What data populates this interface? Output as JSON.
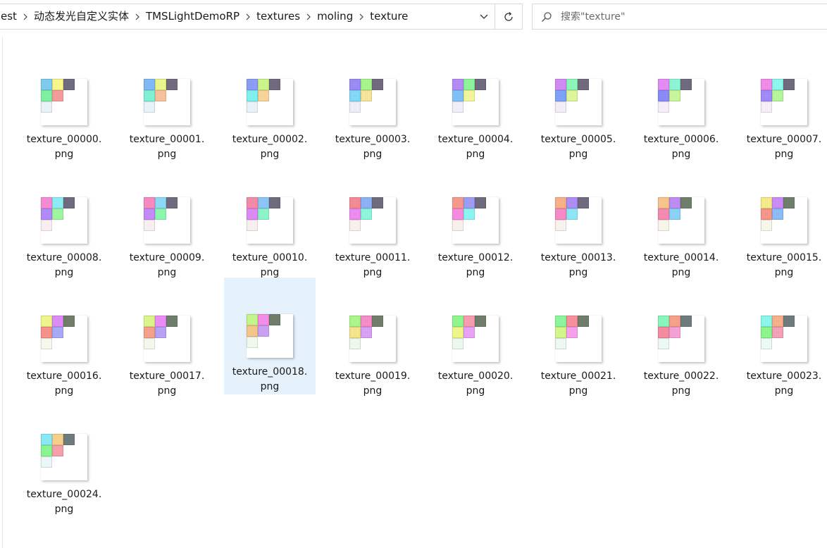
{
  "breadcrumb": {
    "items": [
      "est",
      "动态发光自定义实体",
      "TMSLightDemoRP",
      "textures",
      "moling",
      "texture"
    ]
  },
  "search": {
    "placeholder": "搜索\"texture\""
  },
  "colors": {
    "selection": "#e5f1fb",
    "border": "#d9d9d9"
  },
  "files": [
    {
      "name": "texture_00000.png",
      "line1": "texture_00000.",
      "line2": "png",
      "swatches": [
        "#7ecbf0",
        "#f6f48a",
        "#6f6a7d",
        "#7ff0a2",
        "#f59b9b",
        "#e6f2f8"
      ]
    },
    {
      "name": "texture_00001.png",
      "line1": "texture_00001.",
      "line2": "png",
      "swatches": [
        "#7fb8f5",
        "#e8f58a",
        "#6f6a7d",
        "#80f0d4",
        "#f7c09a",
        "#e6f2f8"
      ]
    },
    {
      "name": "texture_00002.png",
      "line1": "texture_00002.",
      "line2": "png",
      "swatches": [
        "#8a9cf5",
        "#caf58a",
        "#6f6a7d",
        "#7ff0f0",
        "#f7d29a",
        "#e6f2f8"
      ]
    },
    {
      "name": "texture_00003.png",
      "line1": "texture_00003.",
      "line2": "png",
      "swatches": [
        "#9a8af5",
        "#a7f58a",
        "#6f6a7d",
        "#7fd8f7",
        "#f7e39a",
        "#eeeef8"
      ]
    },
    {
      "name": "texture_00004.png",
      "line1": "texture_00004.",
      "line2": "png",
      "swatches": [
        "#b48af5",
        "#8cf59a",
        "#6f6a7d",
        "#7fc0f7",
        "#f2f59a",
        "#f0eef8"
      ]
    },
    {
      "name": "texture_00005.png",
      "line1": "texture_00005.",
      "line2": "png",
      "swatches": [
        "#d08af5",
        "#8cf5b8",
        "#6f6a7d",
        "#7fa0f7",
        "#dcf59a",
        "#f2eef8"
      ]
    },
    {
      "name": "texture_00006.png",
      "line1": "texture_00006.",
      "line2": "png",
      "swatches": [
        "#e38af5",
        "#8cf5d4",
        "#6f6a7d",
        "#8a8af7",
        "#c8f59a",
        "#f5eef8"
      ]
    },
    {
      "name": "texture_00007.png",
      "line1": "texture_00007.",
      "line2": "png",
      "swatches": [
        "#f08ae8",
        "#8cf5ee",
        "#6f6a7d",
        "#a08af7",
        "#b4f59a",
        "#f7eef5"
      ]
    },
    {
      "name": "texture_00008.png",
      "line1": "texture_00008.",
      "line2": "png",
      "swatches": [
        "#f58ad4",
        "#8cecf5",
        "#6f6a7d",
        "#b08af7",
        "#a0f5a0",
        "#f8eef2"
      ]
    },
    {
      "name": "texture_00009.png",
      "line1": "texture_00009.",
      "line2": "png",
      "swatches": [
        "#f58ac0",
        "#8cd8f5",
        "#6f6a7d",
        "#c48af7",
        "#8cf5b0",
        "#f8eef0"
      ]
    },
    {
      "name": "texture_00010.png",
      "line1": "texture_00010.",
      "line2": "png",
      "swatches": [
        "#f58aa8",
        "#8cc4f5",
        "#6f6a7d",
        "#dc8af7",
        "#8cf5c8",
        "#f8eeee"
      ]
    },
    {
      "name": "texture_00011.png",
      "line1": "texture_00011.",
      "line2": "png",
      "swatches": [
        "#f58a96",
        "#8cb0f5",
        "#6f6a7d",
        "#ec8af0",
        "#8cf5dc",
        "#f8eeec"
      ]
    },
    {
      "name": "texture_00012.png",
      "line1": "texture_00012.",
      "line2": "png",
      "swatches": [
        "#f59a8a",
        "#9c9cf5",
        "#6f6a7d",
        "#f58ae0",
        "#8cf5f0",
        "#f8f0ec"
      ]
    },
    {
      "name": "texture_00013.png",
      "line1": "texture_00013.",
      "line2": "png",
      "swatches": [
        "#f5b08a",
        "#ac8cf5",
        "#6f6a7d",
        "#f58ac8",
        "#8ce4f5",
        "#f8f2ec"
      ]
    },
    {
      "name": "texture_00014.png",
      "line1": "texture_00014.",
      "line2": "png",
      "swatches": [
        "#f5c48a",
        "#bc8cf5",
        "#6f7d6a",
        "#f58ab0",
        "#8cd0f5",
        "#f8f4ec"
      ]
    },
    {
      "name": "texture_00015.png",
      "line1": "texture_00015.",
      "line2": "png",
      "swatches": [
        "#f5ea8a",
        "#cc8cf5",
        "#6f7d6a",
        "#f5968a",
        "#8cbcf5",
        "#f8f6ec"
      ]
    },
    {
      "name": "texture_00016.png",
      "line1": "texture_00016.",
      "line2": "png",
      "swatches": [
        "#eef58a",
        "#dc8cf5",
        "#6f7d6a",
        "#f5908a",
        "#a8a8f5",
        "#f6f8ec"
      ]
    },
    {
      "name": "texture_00017.png",
      "line1": "texture_00017.",
      "line2": "png",
      "swatches": [
        "#dcf58a",
        "#ec8cf5",
        "#6f7d6a",
        "#f5a08a",
        "#b8a0f5",
        "#f4f8ec"
      ]
    },
    {
      "name": "texture_00018.png",
      "line1": "texture_00018.",
      "line2": "png",
      "swatches": [
        "#c4f58a",
        "#f58ce8",
        "#6f7d6a",
        "#f5c48a",
        "#c8a0f5",
        "#f0f8ec"
      ]
    },
    {
      "name": "texture_00019.png",
      "line1": "texture_00019.",
      "line2": "png",
      "swatches": [
        "#a8f58a",
        "#f58cc8",
        "#6f7d6a",
        "#f5e48a",
        "#d8a0f5",
        "#eef8ec"
      ]
    },
    {
      "name": "texture_00020.png",
      "line1": "texture_00020.",
      "line2": "png",
      "swatches": [
        "#90f58a",
        "#f59cb0",
        "#6f7d6a",
        "#f0f58a",
        "#eaa0f5",
        "#ecf8ee"
      ]
    },
    {
      "name": "texture_00021.png",
      "line1": "texture_00021.",
      "line2": "png",
      "swatches": [
        "#8af59c",
        "#f5909c",
        "#6f7d6a",
        "#d4f58a",
        "#f5a0e8",
        "#ecf8f0"
      ]
    },
    {
      "name": "texture_00022.png",
      "line1": "texture_00022.",
      "line2": "png",
      "swatches": [
        "#8af5bc",
        "#f5a08a",
        "#6f7a7d",
        "#f58aa0",
        "#f5a0d4",
        "#ecf8f2"
      ]
    },
    {
      "name": "texture_00023.png",
      "line1": "texture_00023.",
      "line2": "png",
      "swatches": [
        "#8af5e8",
        "#f5b08a",
        "#6f7a7d",
        "#8af58a",
        "#f5a0b8",
        "#ecf8f6"
      ]
    },
    {
      "name": "texture_00024.png",
      "line1": "texture_00024.",
      "line2": "png",
      "swatches": [
        "#8ae8f5",
        "#f5d08a",
        "#6f7a7d",
        "#8af590",
        "#f5a0a8",
        "#ecf6f8"
      ]
    }
  ],
  "selected_index": 18
}
